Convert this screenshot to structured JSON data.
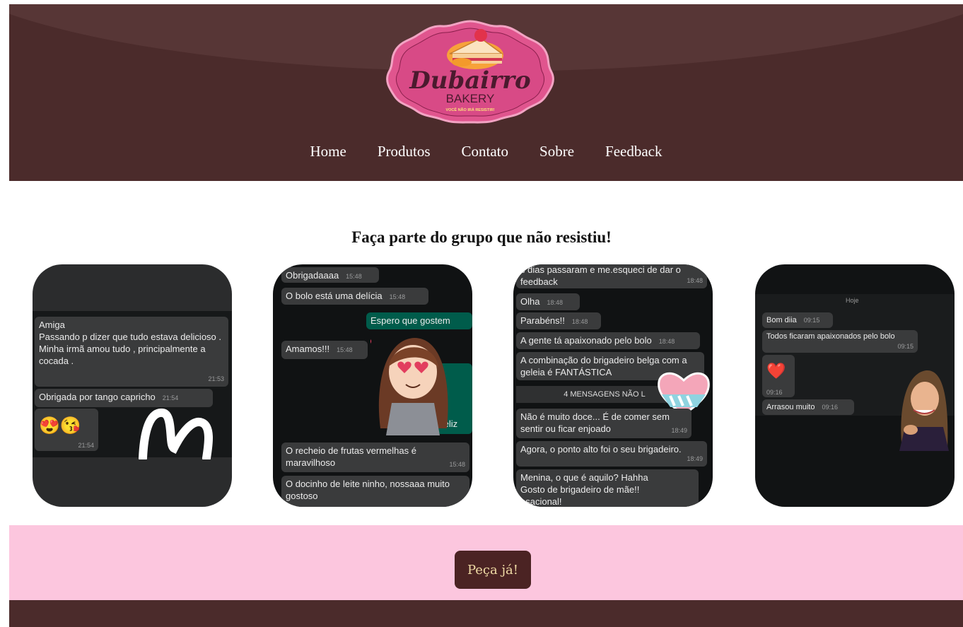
{
  "brand": {
    "name": "Dubairro",
    "sub": "BAKERY",
    "tagline": "VOCÊ NÃO IRÁ RESISTIR!"
  },
  "nav": {
    "items": [
      "Home",
      "Produtos",
      "Contato",
      "Sobre",
      "Feedback"
    ]
  },
  "section": {
    "title": "Faça parte do grupo que não resistiu!"
  },
  "cards": [
    {
      "messages": [
        {
          "text": "Amiga\nPassando p dizer que tudo estava delicioso .\nMinha irmã amou tudo , principalmente a cocada .",
          "time": "21:53"
        },
        {
          "text": "Obrigada por tango capricho",
          "time": "21:54"
        },
        {
          "text": "😍😘",
          "time": "21:54"
        }
      ]
    },
    {
      "messages": [
        {
          "text": "Obrigadaaaa",
          "time": "15:48"
        },
        {
          "text": "O bolo está uma delícia",
          "time": "15:48"
        },
        {
          "text": "Espero que gostem",
          "time": ""
        },
        {
          "text": "Amamos!!!",
          "time": "15:48"
        },
        {
          "text": "feliz",
          "time": ""
        },
        {
          "text": "O recheio de frutas vermelhas é maravilhoso",
          "time": "15:48"
        },
        {
          "text": "O docinho de leite ninho, nossaaa muito gostoso",
          "time": ""
        }
      ]
    },
    {
      "messages": [
        {
          "text": "s dias passaram e me.esqueci de dar o feedback",
          "time": "18:48"
        },
        {
          "text": "Olha",
          "time": "18:48"
        },
        {
          "text": "Parabéns!!",
          "time": "18:48"
        },
        {
          "text": "A gente tá apaixonado pelo bolo",
          "time": "18:48"
        },
        {
          "text": "A combinação do brigadeiro belga com a geleia é FANTÁSTICA",
          "time": ""
        },
        {
          "text": "4 MENSAGENS NÃO L",
          "time": ""
        },
        {
          "text": "Não é muito doce... É de comer sem sentir ou ficar enjoado",
          "time": "18:49"
        },
        {
          "text": "Agora, o ponto alto foi o seu brigadeiro.",
          "time": "18:49"
        },
        {
          "text": "Menina, o que é aquilo? Hahha\nGosto de brigadeiro de mãe!!\nnsacional!",
          "time": ""
        }
      ]
    },
    {
      "messages": [
        {
          "text": "Hoje",
          "time": ""
        },
        {
          "text": "Bom diia",
          "time": "09:15"
        },
        {
          "text": "Todos ficaram apaixonados pelo bolo",
          "time": "09:15"
        },
        {
          "text": "❤️",
          "time": "09:16"
        },
        {
          "text": "Arrasou muito",
          "time": "09:16"
        }
      ]
    }
  ],
  "cta": {
    "label": "Peça já!"
  },
  "colors": {
    "header": "#4b2b2b",
    "band": "#fcc6de",
    "cta_bg": "#4b2323",
    "cta_text": "#f0dba5",
    "logo_pink": "#e0558e"
  }
}
